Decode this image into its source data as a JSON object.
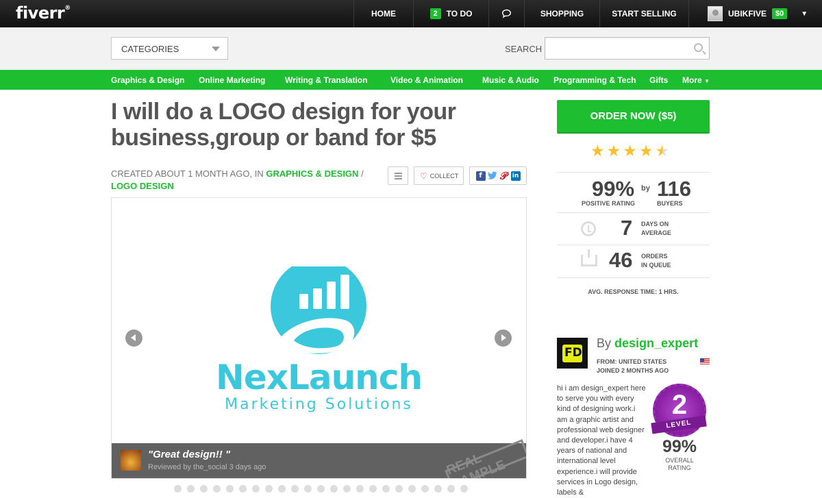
{
  "topbar": {
    "logo": "fiverr",
    "logo_mark": "®",
    "nav": {
      "home": "HOME",
      "todo_count": "2",
      "todo": "TO DO",
      "shopping": "SHOPPING",
      "start_selling": "START SELLING",
      "username": "UBIKFIVE",
      "balance": "$0"
    }
  },
  "search": {
    "categories_label": "CATEGORIES",
    "label": "SEARCH",
    "value": ""
  },
  "categories": [
    "Graphics & Design",
    "Online Marketing",
    "Writing & Translation",
    "Video & Animation",
    "Music & Audio",
    "Programming & Tech",
    "Gifts",
    "More"
  ],
  "gig": {
    "title": "I will do a LOGO design for your business,group or band for $5",
    "created": "CREATED ABOUT 1 MONTH AGO, IN",
    "category": "GRAPHICS & DESIGN",
    "separator": "/",
    "subcategory": "LOGO DESIGN",
    "collect": "COLLECT"
  },
  "gallery": {
    "brand_name": "NexLaunch",
    "brand_sub": "Marketing Solutions",
    "review_quote": "\"Great design!! \"",
    "review_by": "Reviewed by the_social 3 days ago",
    "stamp": "REAL SAMPLE",
    "dot_count": 23
  },
  "order": {
    "button": "ORDER NOW ($5)",
    "rating_stars": 4.5
  },
  "stats": {
    "positive_pct": "99%",
    "positive_label": "POSITIVE RATING",
    "by": "by",
    "buyers": "116",
    "buyers_label": "BUYERS",
    "days": "7",
    "days_label_1": "DAYS ON",
    "days_label_2": "AVERAGE",
    "orders": "46",
    "orders_label_1": "ORDERS",
    "orders_label_2": "IN QUEUE",
    "response_label": "AVG. RESPONSE TIME:",
    "response_value": "1 HRS."
  },
  "seller": {
    "by": "By",
    "name": "design_expert",
    "from": "FROM: UNITED STATES",
    "joined": "JOINED 2 MONTHS AGO",
    "bio": "hi i am design_expert here to serve you with every kind of designing work.i am a graphic artist and professional web designer and developer.i have 4 years of national and international level experience.i will provide services in Logo design, labels &",
    "level": "2",
    "level_label": "LEVEL",
    "overall_pct": "99%",
    "overall_label_1": "OVERALL",
    "overall_label_2": "RATING"
  },
  "colors": {
    "brand_green": "#1dbf31",
    "logo_cyan": "#3cc8dc",
    "level_purple": "#8e22a8"
  }
}
